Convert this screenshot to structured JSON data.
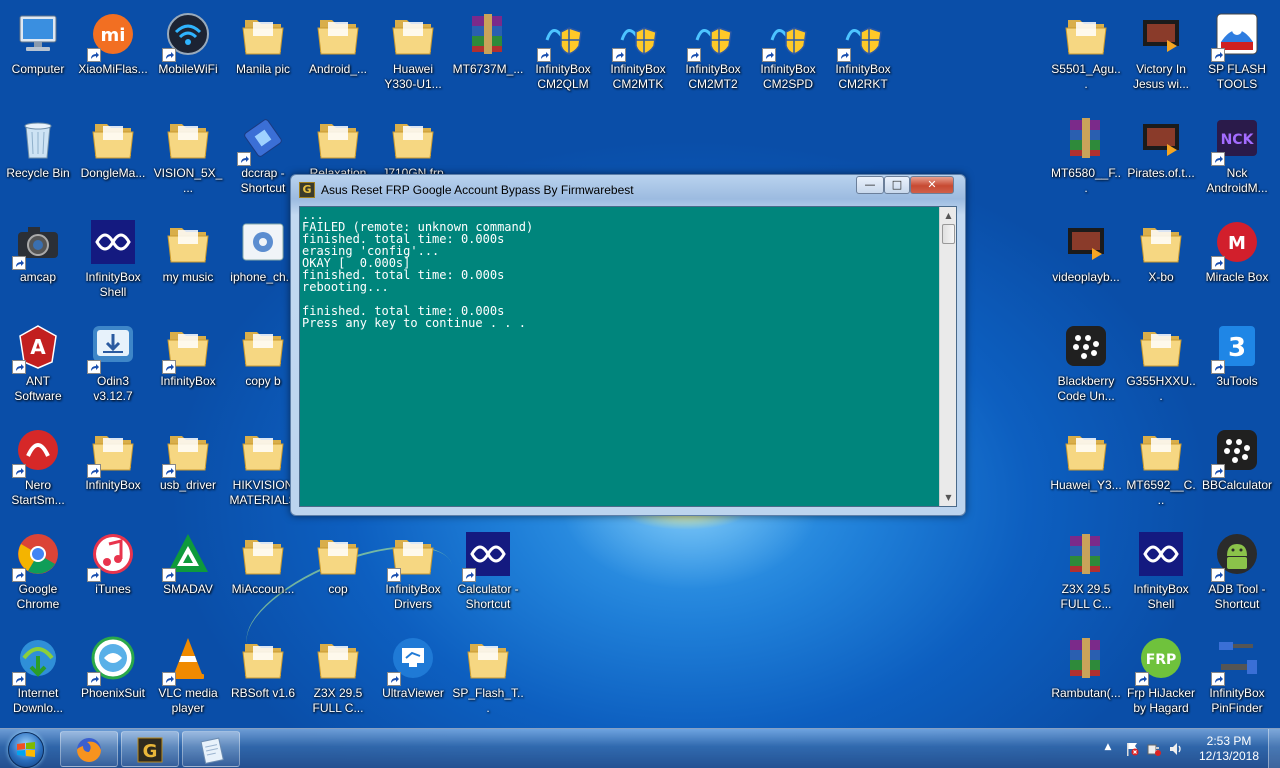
{
  "desktop": {
    "icons": [
      {
        "label": "Computer",
        "icon": "computer-icon",
        "shortcut": false
      },
      {
        "label": "XiaoMiFlas...",
        "icon": "xiaomi-icon",
        "shortcut": true
      },
      {
        "label": "MobileWiFi",
        "icon": "wifi-icon",
        "shortcut": true
      },
      {
        "label": "Manila pic",
        "icon": "folder-icon",
        "shortcut": false
      },
      {
        "label": "Android_...",
        "icon": "folder-icon",
        "shortcut": false
      },
      {
        "label": "Huawei Y330-U1...",
        "icon": "folder-icon",
        "shortcut": false
      },
      {
        "label": "MT6737M_...",
        "icon": "winrar-icon",
        "shortcut": false
      },
      {
        "label": "InfinityBox CM2QLM",
        "icon": "infinitybox-cm2-icon",
        "shortcut": true
      },
      {
        "label": "InfinityBox CM2MTK",
        "icon": "infinitybox-cm2-icon",
        "shortcut": true
      },
      {
        "label": "InfinityBox CM2MT2",
        "icon": "infinitybox-cm2-icon",
        "shortcut": true
      },
      {
        "label": "InfinityBox CM2SPD",
        "icon": "infinitybox-cm2-icon",
        "shortcut": true
      },
      {
        "label": "InfinityBox CM2RKT",
        "icon": "infinitybox-cm2-icon",
        "shortcut": true
      },
      {
        "label": "Recycle Bin",
        "icon": "recycle-bin-icon",
        "shortcut": false
      },
      {
        "label": "DongleMa...",
        "icon": "folder-icon",
        "shortcut": false
      },
      {
        "label": "VISION_5X_...",
        "icon": "folder-icon",
        "shortcut": false
      },
      {
        "label": "dccrap - Shortcut",
        "icon": "usb-device-icon",
        "shortcut": true
      },
      {
        "label": "Relaxation",
        "icon": "folder-icon",
        "shortcut": false
      },
      {
        "label": "J710GN frp",
        "icon": "folder-icon",
        "shortcut": false
      },
      {
        "label": "amcap",
        "icon": "camera-icon",
        "shortcut": true
      },
      {
        "label": "InfinityBox Shell",
        "icon": "infinitybox-icon",
        "shortcut": false
      },
      {
        "label": "my music",
        "icon": "folder-icon",
        "shortcut": false
      },
      {
        "label": "iphone_ch...",
        "icon": "gear-settings-icon",
        "shortcut": false
      },
      {
        "label": "ANT Software",
        "icon": "ant-software-icon",
        "shortcut": true
      },
      {
        "label": "Odin3 v3.12.7",
        "icon": "odin-download-icon",
        "shortcut": true
      },
      {
        "label": "InfinityBox",
        "icon": "folder-icon",
        "shortcut": true
      },
      {
        "label": "copy b",
        "icon": "folder-icon",
        "shortcut": false
      },
      {
        "label": "Nero StartSm...",
        "icon": "nero-icon",
        "shortcut": true
      },
      {
        "label": "InfinityBox",
        "icon": "folder-icon",
        "shortcut": true
      },
      {
        "label": "usb_driver",
        "icon": "folder-icon",
        "shortcut": true
      },
      {
        "label": "HIKVISION MATERIALS",
        "icon": "folder-icon",
        "shortcut": false
      },
      {
        "label": "Google Chrome",
        "icon": "chrome-icon",
        "shortcut": true
      },
      {
        "label": "iTunes",
        "icon": "itunes-icon",
        "shortcut": true
      },
      {
        "label": "SMADAV",
        "icon": "smadav-icon",
        "shortcut": true
      },
      {
        "label": "MiAccoun...",
        "icon": "folder-icon",
        "shortcut": false
      },
      {
        "label": "cop",
        "icon": "folder-icon",
        "shortcut": false
      },
      {
        "label": "InfinityBox Drivers",
        "icon": "folder-icon",
        "shortcut": true
      },
      {
        "label": "Calculator - Shortcut",
        "icon": "infinitybox-icon",
        "shortcut": true
      },
      {
        "label": "Internet Downlo...",
        "icon": "idm-icon",
        "shortcut": true
      },
      {
        "label": "PhoenixSuit",
        "icon": "phoenixsuit-icon",
        "shortcut": true
      },
      {
        "label": "VLC media player",
        "icon": "vlc-icon",
        "shortcut": true
      },
      {
        "label": "RBSoft v1.6",
        "icon": "folder-icon",
        "shortcut": false
      },
      {
        "label": "Z3X 29.5 FULL C...",
        "icon": "folder-icon",
        "shortcut": false
      },
      {
        "label": "UltraViewer",
        "icon": "ultraviewer-icon",
        "shortcut": true
      },
      {
        "label": "SP_Flash_T...",
        "icon": "folder-icon",
        "shortcut": false
      },
      {
        "label": "S5501_Agu...",
        "icon": "folder-icon",
        "shortcut": false
      },
      {
        "label": "Victory In Jesus wi...",
        "icon": "video-icon",
        "shortcut": false
      },
      {
        "label": "SP FLASH TOOLS",
        "icon": "sp-flash-icon",
        "shortcut": true
      },
      {
        "label": "MT6580__F...",
        "icon": "winrar-icon",
        "shortcut": false
      },
      {
        "label": "Pirates.of.t...",
        "icon": "video-icon",
        "shortcut": false
      },
      {
        "label": "Nck AndroidM...",
        "icon": "nck-icon",
        "shortcut": true
      },
      {
        "label": "videoplayb...",
        "icon": "video-icon",
        "shortcut": false
      },
      {
        "label": "X-bo",
        "icon": "folder-icon",
        "shortcut": false
      },
      {
        "label": "Miracle Box",
        "icon": "miracle-box-icon",
        "shortcut": true
      },
      {
        "label": "Blackberry Code Un...",
        "icon": "blackberry-icon",
        "shortcut": false
      },
      {
        "label": "G355HXXU...",
        "icon": "folder-icon",
        "shortcut": false
      },
      {
        "label": "3uTools",
        "icon": "3utools-icon",
        "shortcut": true
      },
      {
        "label": "Huawei_Y3...",
        "icon": "folder-icon",
        "shortcut": false
      },
      {
        "label": "MT6592__C...",
        "icon": "folder-icon",
        "shortcut": false
      },
      {
        "label": "BBCalculator",
        "icon": "blackberry-icon",
        "shortcut": true
      },
      {
        "label": "Z3X 29.5 FULL C...",
        "icon": "winrar-icon",
        "shortcut": false
      },
      {
        "label": "InfinityBox Shell",
        "icon": "infinitybox-icon",
        "shortcut": false
      },
      {
        "label": "ADB Tool - Shortcut",
        "icon": "android-icon",
        "shortcut": true
      },
      {
        "label": "Rambutan(...",
        "icon": "winrar-icon",
        "shortcut": false
      },
      {
        "label": "Frp HiJacker by Hagard",
        "icon": "frp-hijacker-icon",
        "shortcut": true
      },
      {
        "label": "InfinityBox PinFinder",
        "icon": "pinfinder-icon",
        "shortcut": true
      }
    ]
  },
  "window": {
    "title": "Asus Reset FRP Google Account Bypass By Firmwarebest",
    "app_icon_glyph": "G",
    "min_glyph": "—",
    "max_glyph": "□",
    "close_glyph": "✕",
    "console_lines": [
      "...",
      "FAILED (remote: unknown command)",
      "finished. total time: 0.000s",
      "erasing 'config'...",
      "OKAY [  0.000s]",
      "finished. total time: 0.000s",
      "rebooting...",
      "",
      "finished. total time: 0.000s",
      "Press any key to continue . . ."
    ],
    "console_bg": "#00857c",
    "scroll_up_glyph": "▲",
    "scroll_down_glyph": "▼"
  },
  "taskbar": {
    "items": [
      {
        "name": "firefox",
        "icon": "firefox-icon"
      },
      {
        "name": "frp-tool",
        "icon": "frp-tool-g-icon"
      },
      {
        "name": "notepad",
        "icon": "notepad-icon"
      }
    ],
    "tray": {
      "up_arrow": "▲",
      "time": "2:53 PM",
      "date": "12/13/2018"
    }
  },
  "colors": {
    "folder": "#f3d27a",
    "infinity_blue": "#1a2a8c",
    "taskbar": "#2d5c9a"
  }
}
